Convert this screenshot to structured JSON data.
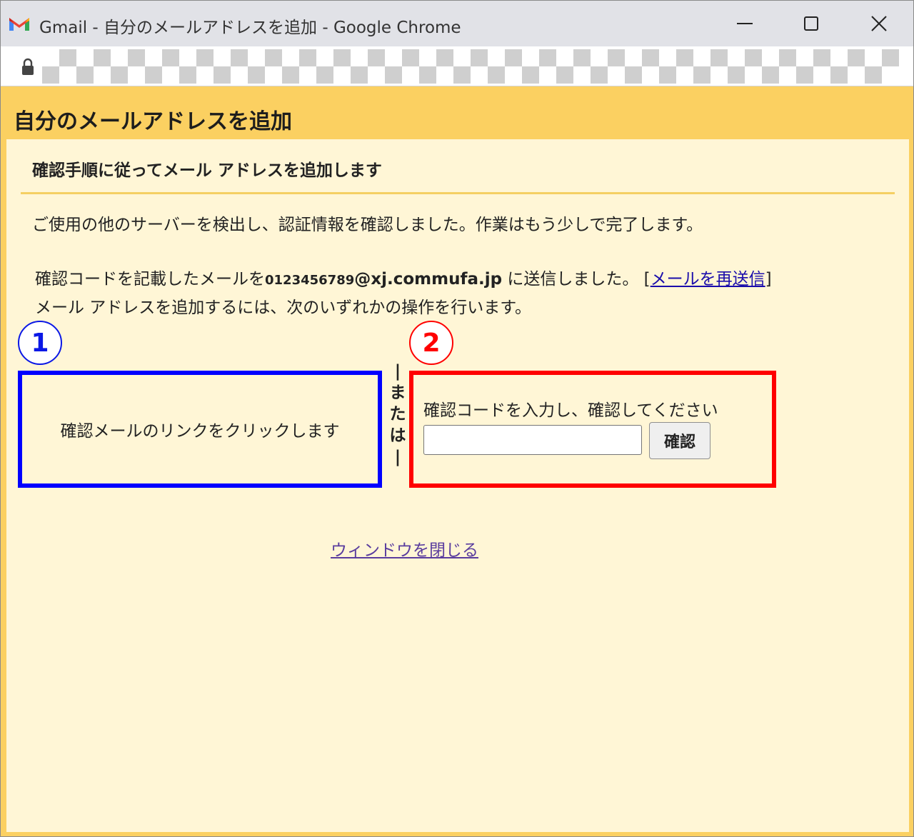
{
  "window": {
    "title": "Gmail - 自分のメールアドレスを追加 - Google Chrome"
  },
  "page": {
    "title": "自分のメールアドレスを追加",
    "subtitle": "確認手順に従ってメール アドレスを追加します",
    "detected_message": "ご使用の他のサーバーを検出し、認証情報を確認しました。作業はもう少しで完了します。",
    "sent_prefix": "確認コードを記載したメールを",
    "email_local": "0123456789",
    "email_domain": "@xj.commufa.jp",
    "sent_suffix": " に送信しました。 [",
    "resend_link": "メールを再送信",
    "resend_close": "]",
    "instruction": "メール アドレスを追加するには、次のいずれかの操作を行います。",
    "close_link": "ウィンドウを閉じる"
  },
  "options": {
    "badge_1": "1",
    "badge_2": "2",
    "option1_text": "確認メールのリンクをクリックします",
    "or_chars": [
      "|",
      "ま",
      "た",
      "は",
      "|"
    ],
    "option2_label": "確認コードを入力し、確認してください",
    "code_input_value": "",
    "confirm_button": "確認"
  },
  "colors": {
    "header_bg": "#fbd061",
    "content_bg": "#fff6d6",
    "option1_border": "#0000ff",
    "option2_border": "#ff0000",
    "link": "#1a0dab"
  },
  "icons": {
    "gmail": "gmail-logo-icon",
    "lock": "lock-icon",
    "minimize": "minimize-icon",
    "maximize": "maximize-icon",
    "close": "close-icon"
  }
}
